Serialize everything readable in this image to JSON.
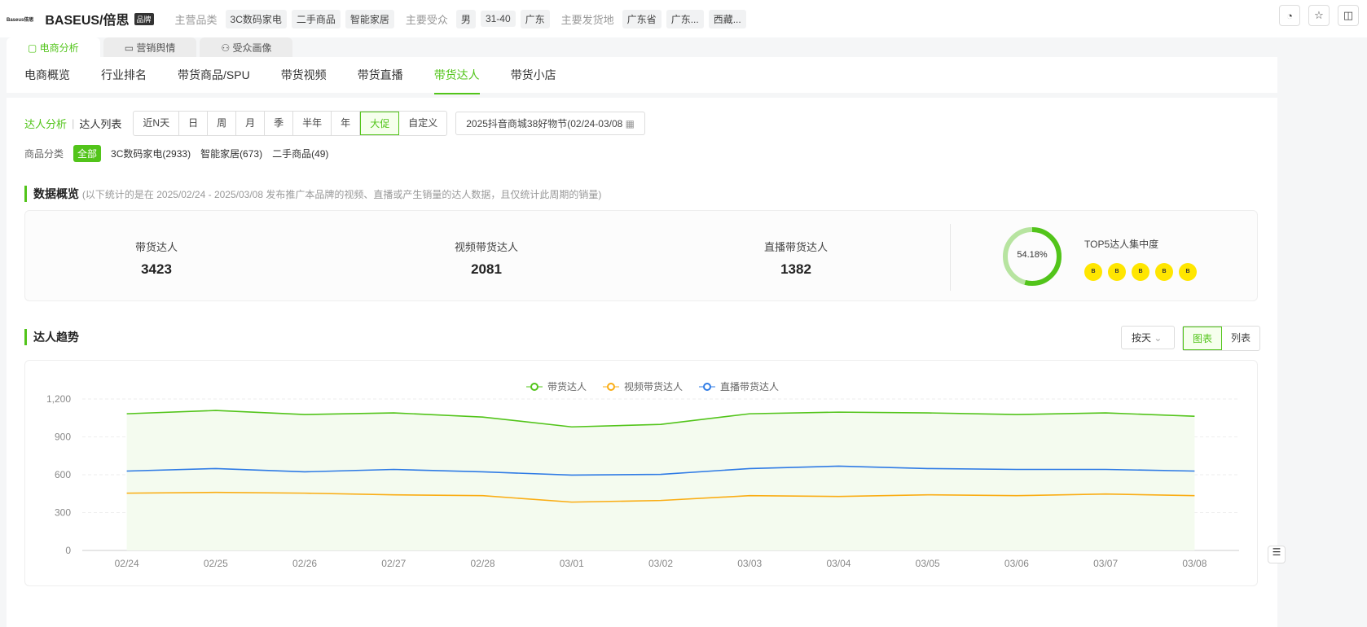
{
  "header": {
    "logo": "Baseus倍思",
    "brand": "BASEUS/倍思",
    "badge": "品牌",
    "cat_label": "主营品类",
    "cats": [
      "3C数码家电",
      "二手商品",
      "智能家居"
    ],
    "aud_label": "主要受众",
    "aud": [
      "男",
      "31-40",
      "广东"
    ],
    "ship_label": "主要发货地",
    "ship": [
      "广东省",
      "广东...",
      "西藏..."
    ]
  },
  "top_tabs": [
    "电商分析",
    "营销舆情",
    "受众画像"
  ],
  "nav_tabs": [
    "电商概览",
    "行业排名",
    "带货商品/SPU",
    "带货视频",
    "带货直播",
    "带货达人",
    "带货小店"
  ],
  "sub": {
    "analysis": "达人分析",
    "list": "达人列表",
    "periods": [
      "近N天",
      "日",
      "周",
      "月",
      "季",
      "半年",
      "年",
      "大促",
      "自定义"
    ],
    "date": "2025抖音商城38好物节(02/24-03/08"
  },
  "category": {
    "label": "商品分类",
    "items": [
      "全部",
      "3C数码家电(2933)",
      "智能家居(673)",
      "二手商品(49)"
    ]
  },
  "overview": {
    "title": "数据概览",
    "note": "(以下统计的是在 2025/02/24 - 2025/03/08 发布推广本品牌的视频、直播或产生销量的达人数据，且仅统计此周期的销量)",
    "stats": [
      {
        "label": "带货达人",
        "value": "3423"
      },
      {
        "label": "视频带货达人",
        "value": "2081"
      },
      {
        "label": "直播带货达人",
        "value": "1382"
      }
    ],
    "top5_label": "TOP5达人集中度",
    "top5_value": "54.18%",
    "top5_pct": 54.18
  },
  "trend": {
    "title": "达人趋势",
    "granularity": "按天",
    "view_chart": "图表",
    "view_list": "列表"
  },
  "chart_data": {
    "type": "line",
    "x": [
      "02/24",
      "02/25",
      "02/26",
      "02/27",
      "02/28",
      "03/01",
      "03/02",
      "03/03",
      "03/04",
      "03/05",
      "03/06",
      "03/07",
      "03/08"
    ],
    "ylim": [
      0,
      1200
    ],
    "yticks": [
      "0",
      "300",
      "600",
      "900",
      "1,200"
    ],
    "legend": "top-center",
    "series": [
      {
        "name": "带货达人",
        "color": "#52c41a",
        "values": [
          1083,
          1109,
          1077,
          1090,
          1057,
          979,
          999,
          1083,
          1096,
          1090,
          1077,
          1090,
          1063
        ]
      },
      {
        "name": "视频带货达人",
        "color": "#faad14",
        "values": [
          454,
          460,
          454,
          441,
          434,
          383,
          396,
          434,
          428,
          441,
          434,
          447,
          434
        ]
      },
      {
        "name": "直播带货达人",
        "color": "#2f7be5",
        "values": [
          629,
          649,
          623,
          642,
          623,
          597,
          603,
          649,
          668,
          649,
          642,
          642,
          629
        ]
      }
    ]
  }
}
